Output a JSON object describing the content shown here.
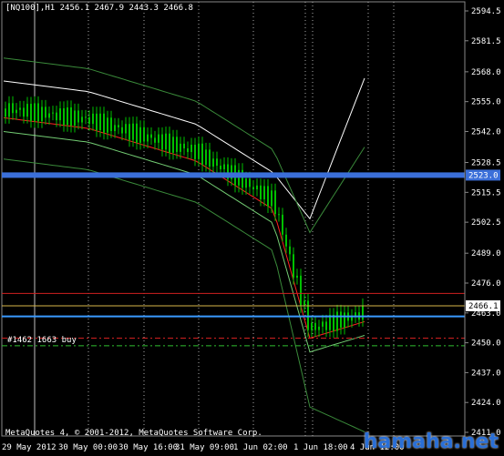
{
  "header": {
    "symbol": "[NQ100],H1",
    "ohlc": "2456.1 2467.9 2443.3 2466.8"
  },
  "price_axis": {
    "ticks": [
      "2594.5",
      "2581.5",
      "2568.0",
      "2555.0",
      "2542.0",
      "2528.5",
      "2515.5",
      "2502.5",
      "2489.0",
      "2476.0",
      "2463.0",
      "2450.0",
      "2437.0",
      "2424.0",
      "2411.0"
    ],
    "tick_values": [
      2594.5,
      2581.5,
      2568.0,
      2555.0,
      2542.0,
      2528.5,
      2515.5,
      2502.5,
      2489.0,
      2476.0,
      2463.0,
      2450.0,
      2437.0,
      2424.0,
      2411.0
    ],
    "ymin": 2411.0,
    "ymax": 2594.5
  },
  "time_axis": {
    "labels": [
      "29 May 2012",
      "30 May 00:00",
      "30 May 16:00",
      "31 May 09:00",
      "1 Jun 02:00",
      "1 Jun 18:00",
      "4 Jun 12:00"
    ]
  },
  "markers": {
    "level_blue": {
      "label": "2523.0",
      "value": 2523.0,
      "color": "#3b6fd9"
    },
    "current_price": {
      "label": "2466.1",
      "value": 2466.1,
      "color": "#d8b64a"
    },
    "red_line_value": 2471.5,
    "blue_line_value": 2461.5,
    "order_red_dash": 2452.0,
    "order_green_dash": 2448.7
  },
  "trade_label": "#1462 1663 buy",
  "copyright": "MetaQuotes 4, © 2001-2012, MetaQuotes Software Corp.",
  "watermark": "hamaha.net",
  "colors": {
    "candle": "#00c000",
    "ema_white": "#ffffff",
    "ma_red": "#ff2020",
    "band_green": "#3a8a3a",
    "grid_dot": "#aaaaaa"
  }
}
